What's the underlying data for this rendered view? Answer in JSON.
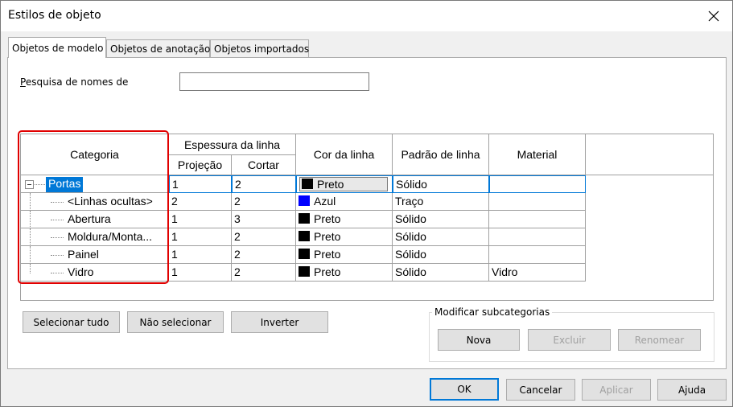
{
  "window": {
    "title": "Estilos de objeto"
  },
  "tabs": [
    {
      "label": "Objetos de modelo"
    },
    {
      "label": "Objetos de anotação"
    },
    {
      "label": "Objetos importados"
    }
  ],
  "search": {
    "label": "Pesquisa de nomes de",
    "value": ""
  },
  "table": {
    "headers": {
      "categoria": "Categoria",
      "espessura": "Espessura da linha",
      "projecao": "Projeção",
      "cortar": "Cortar",
      "cor": "Cor da linha",
      "padrao": "Padrão de linha",
      "material": "Material"
    },
    "rows": [
      {
        "categoria": "Portas",
        "projecao": "1",
        "cortar": "2",
        "cor": "Preto",
        "cor_hex": "#000000",
        "padrao": "Sólido",
        "material": ""
      },
      {
        "categoria": "<Linhas ocultas>",
        "projecao": "2",
        "cortar": "2",
        "cor": "Azul",
        "cor_hex": "#0000ff",
        "padrao": "Traço",
        "material": ""
      },
      {
        "categoria": "Abertura",
        "projecao": "1",
        "cortar": "3",
        "cor": "Preto",
        "cor_hex": "#000000",
        "padrao": "Sólido",
        "material": ""
      },
      {
        "categoria": "Moldura/Monta...",
        "projecao": "1",
        "cortar": "2",
        "cor": "Preto",
        "cor_hex": "#000000",
        "padrao": "Sólido",
        "material": ""
      },
      {
        "categoria": "Painel",
        "projecao": "1",
        "cortar": "2",
        "cor": "Preto",
        "cor_hex": "#000000",
        "padrao": "Sólido",
        "material": ""
      },
      {
        "categoria": "Vidro",
        "projecao": "1",
        "cortar": "2",
        "cor": "Preto",
        "cor_hex": "#000000",
        "padrao": "Sólido",
        "material": "Vidro"
      }
    ]
  },
  "buttons": {
    "select_all": "Selecionar tudo",
    "deselect": "Não selecionar",
    "invert": "Inverter",
    "new": "Nova",
    "delete": "Excluir",
    "rename": "Renomear",
    "ok": "OK",
    "cancel": "Cancelar",
    "apply": "Aplicar",
    "help": "Ajuda"
  },
  "subcategories": {
    "label": "Modificar subcategorias"
  },
  "colors": {
    "selection": "#0078d7",
    "highlight_box": "#e00000"
  }
}
